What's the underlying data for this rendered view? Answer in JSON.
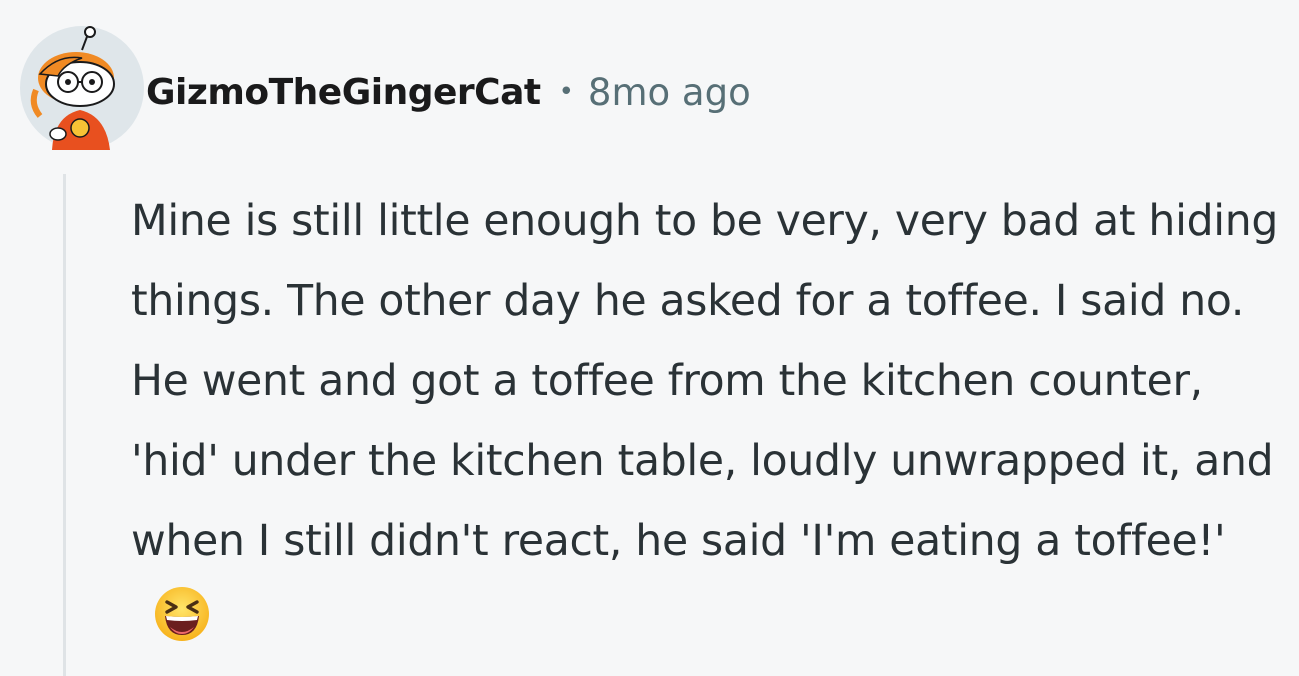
{
  "comment": {
    "author": "GizmoTheGingerCat",
    "separator": "•",
    "timestamp": "8mo ago",
    "body": "Mine is still little enough to be very, very bad at hiding things. The other day he asked for a toffee. I said no. He went and got a toffee from the kitchen counter, 'hid' under the kitchen table, loudly unwrapped it, and when I still didn't react, he said 'I'm eating a toffee!'",
    "avatar_icon": "snoo-avatar-icon",
    "emoji_icon": "grinning-squinting-face-icon"
  },
  "colors": {
    "background": "#f6f7f8",
    "username": "#1a1a1b",
    "meta": "#576f76",
    "body_text": "#2a3236",
    "thread_line": "#dfe3e6"
  }
}
